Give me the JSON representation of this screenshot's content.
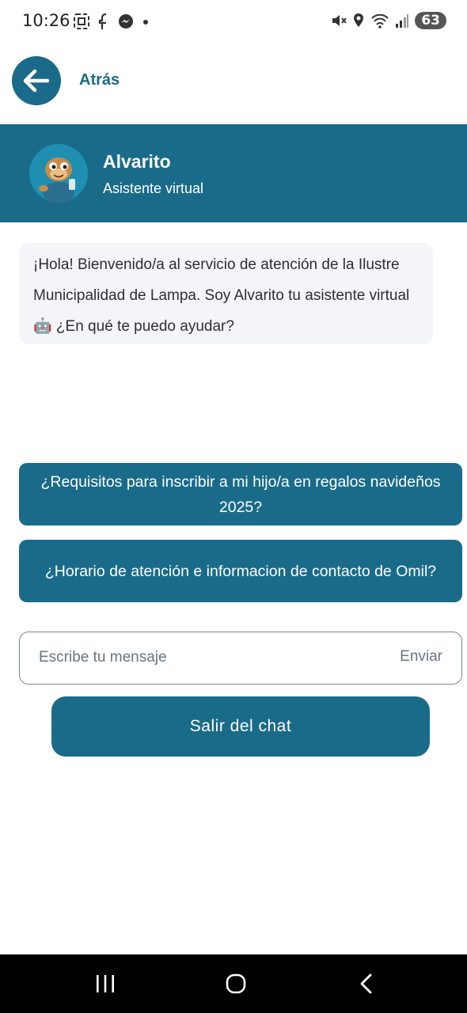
{
  "status_bar": {
    "time": "10:26",
    "battery": "63",
    "left_icons": [
      "screenshot-icon",
      "facebook-icon",
      "messenger-icon",
      "dot-icon"
    ],
    "right_icons": [
      "mute-icon",
      "location-icon",
      "wifi-icon",
      "signal-icon",
      "battery-icon"
    ]
  },
  "header": {
    "back_label": "Atrás"
  },
  "chat": {
    "assistant_name": "Alvarito",
    "assistant_role": "Asistente virtual",
    "message": "¡Hola! Bienvenido/a al servicio de atención de la Ilustre Municipalidad de Lampa. Soy Alvarito tu asistente virtual 🤖 ¿En qué te puedo ayudar?"
  },
  "quick_replies": [
    {
      "label": "¿Requisitos para inscribir a mi hijo/a en regalos navideños 2025?"
    },
    {
      "label": "¿Horario de atención e informacion de contacto de Omil?"
    }
  ],
  "input": {
    "placeholder": "Escribe tu mensaje",
    "send_label": "Enviar"
  },
  "exit_label": "Salir del chat",
  "colors": {
    "primary": "#1a6b8a",
    "bubble_bg": "#f3f5f8",
    "nav_bg": "#000000"
  }
}
